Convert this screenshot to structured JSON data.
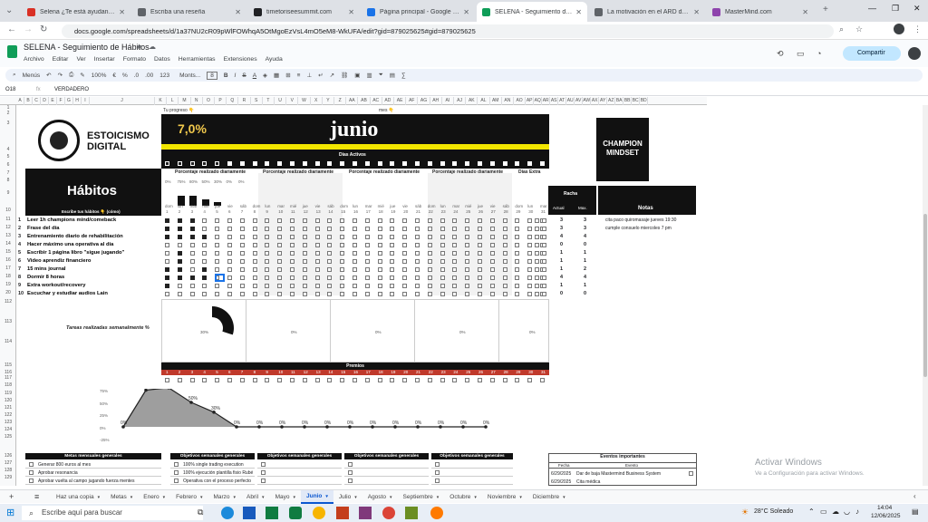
{
  "browser": {
    "tabs": [
      {
        "title": "Selena ¿Te está ayudando tu pi",
        "color": "#d93025"
      },
      {
        "title": "Escriba una reseña",
        "color": "#5f6368"
      },
      {
        "title": "timetoriseesummit.com",
        "color": "#202124"
      },
      {
        "title": "Página principal - Google Drive",
        "color": "#1a73e8"
      },
      {
        "title": "SELENA - Seguimiento de Háb",
        "color": "#0f9d58"
      },
      {
        "title": "La motivación en el ARD desd",
        "color": "#5f6368"
      },
      {
        "title": "MasterMind.com",
        "color": "#8e44ad"
      }
    ],
    "url": "docs.google.com/spreadsheets/d/1a37NU2cR09pWlFOWhqA5OtMgoEzVsL4mO5eM8-WkUFA/edit?gid=879025625#gid=879025625"
  },
  "doc": {
    "title": "SELENA - Seguimiento de Hábitos",
    "menu": [
      "Archivo",
      "Editar",
      "Ver",
      "Insertar",
      "Formato",
      "Datos",
      "Herramientas",
      "Extensiones",
      "Ayuda"
    ],
    "share": "Compartir"
  },
  "toolbar": {
    "menus": "Menús",
    "zoom": "100%",
    "font": "Monts...",
    "size": "8",
    "pct": "%",
    "fmt1": ".0",
    "fmt2": ".00",
    "fmt3": "123"
  },
  "formula": {
    "cell": "O18",
    "value": "VERDADERO"
  },
  "columns": [
    "A",
    "B",
    "C",
    "D",
    "E",
    "F",
    "G",
    "H",
    "I",
    "J",
    "K",
    "L",
    "M",
    "N",
    "O",
    "P",
    "Q",
    "R",
    "S",
    "T",
    "U",
    "V",
    "W",
    "X",
    "Y",
    "Z",
    "AA",
    "AB",
    "AC",
    "AD",
    "AE",
    "AF",
    "AG",
    "AH",
    "AI",
    "AJ",
    "AK",
    "AL",
    "AM",
    "AN",
    "AO",
    "AP",
    "AQ",
    "AR",
    "AS",
    "AT",
    "AU",
    "AV",
    "AW",
    "AX",
    "AY",
    "AZ",
    "BA",
    "BB",
    "BC",
    "BD"
  ],
  "rows": [
    "1",
    "2",
    "3",
    "4",
    "5",
    "6",
    "7",
    "8",
    "9",
    "10",
    "11",
    "12",
    "13",
    "14",
    "15",
    "16",
    "17",
    "18",
    "19",
    "20",
    "112",
    "113",
    "114",
    "115",
    "116",
    "117",
    "118",
    "119",
    "120",
    "121",
    "122",
    "123",
    "124",
    "125",
    "126",
    "127",
    "128",
    "129"
  ],
  "header": {
    "brand1": "ESTOICISMO",
    "brand2": "DIGITAL",
    "progress_label": "Tu progreso 👇",
    "progress": "7,0%",
    "month_label": "mes 👇",
    "month": "junio",
    "days_active": "Días Activos",
    "pct_label": "Porcentaje realizado diariamente",
    "extra_days": "Días Extra",
    "habits_title": "Hábitos",
    "habits_sub": "Escribe tus hábitos 👇 (cómo)",
    "racha": "Racha",
    "actual": "Actual",
    "max": "Max.",
    "notas": "Notas",
    "champion1": "CHAMPION",
    "champion2": "MINDSET"
  },
  "days_short": [
    "dom",
    "lun",
    "mar",
    "mié",
    "jue",
    "vie",
    "sáb"
  ],
  "habits": [
    {
      "n": "1",
      "name": "Leer 1h champions mind/comeback",
      "actual": "3",
      "max": "3",
      "note": "cita paco quiromasaje jueves 19:30",
      "checks": [
        1,
        1,
        1,
        0,
        0
      ]
    },
    {
      "n": "2",
      "name": "Frase del día",
      "actual": "3",
      "max": "3",
      "note": "cumple consuelo miercoles 7 pm",
      "checks": [
        1,
        1,
        1,
        0,
        0
      ]
    },
    {
      "n": "3",
      "name": "Entrenamiento diario de rehabilitación",
      "actual": "4",
      "max": "4",
      "note": "",
      "checks": [
        1,
        1,
        1,
        1,
        0
      ]
    },
    {
      "n": "4",
      "name": "Hacer máximo una operativa al día",
      "actual": "0",
      "max": "0",
      "note": "",
      "checks": [
        0,
        0,
        0,
        0,
        0
      ]
    },
    {
      "n": "5",
      "name": "Escribir 1 página libro \"sigue jugando\"",
      "actual": "1",
      "max": "1",
      "note": "",
      "checks": [
        0,
        1,
        0,
        0,
        0
      ]
    },
    {
      "n": "6",
      "name": "Video aprendiz financiero",
      "actual": "1",
      "max": "1",
      "note": "",
      "checks": [
        0,
        1,
        0,
        0,
        0
      ]
    },
    {
      "n": "7",
      "name": "15 mins journal",
      "actual": "1",
      "max": "2",
      "note": "",
      "checks": [
        1,
        1,
        0,
        1,
        0
      ]
    },
    {
      "n": "8",
      "name": "Dormir 8 horas",
      "actual": "4",
      "max": "4",
      "note": "",
      "checks": [
        1,
        1,
        1,
        1,
        0
      ]
    },
    {
      "n": "9",
      "name": "Extra workout/recovery",
      "actual": "1",
      "max": "1",
      "note": "",
      "checks": [
        1,
        0,
        0,
        0,
        0
      ]
    },
    {
      "n": "10",
      "name": "Escuchar y estudiar audios Lain",
      "actual": "0",
      "max": "0",
      "note": "",
      "checks": [
        0,
        0,
        0,
        0,
        0
      ]
    }
  ],
  "pct_row": [
    "0%",
    "75%",
    "80%",
    "50%",
    "30%",
    "0%",
    "0%"
  ],
  "weekly": {
    "label": "Tareas realizadas semanalmente %",
    "values": [
      "30%",
      "0%",
      "0%",
      "0%",
      "0%"
    ]
  },
  "premios": "Premios",
  "line_chart": {
    "y_ticks": [
      "75%",
      "50%",
      "25%",
      "0%",
      "-25%"
    ],
    "labels": [
      "0%",
      "75%",
      "80%",
      "50%",
      "30%",
      "0%",
      "0%",
      "0%",
      "0%",
      "0%",
      "0%",
      "0%",
      "0%",
      "0%",
      "0%",
      "0%",
      "0%"
    ]
  },
  "goals": {
    "headers": [
      "Metas mensuales generales",
      "Objetivos semanales generales",
      "Objetivos semanales generales",
      "Objetivos semanales generales",
      "Objetivos semanales generales"
    ],
    "monthly": [
      "Generar 800 euros al mes",
      "Aprobar resonancia",
      "Aprobar vuelta al campo jugando fuerza mentes"
    ],
    "week1": [
      "100% single trading execution",
      "100% ejecución plantilla fisio Rubén",
      "Operativa con el proceso perfecto"
    ]
  },
  "events": {
    "title": "Eventos importantes",
    "fecha": "Fecha",
    "evento": "Evento",
    "rows": [
      {
        "date": "6/29/2025",
        "text": "Dar de baja Mastermind Business System"
      },
      {
        "date": "6/29/2025",
        "text": "Cita médica"
      }
    ]
  },
  "watermark": {
    "line1": "Activar Windows",
    "line2": "Ve a Configuración para activar Windows."
  },
  "sheets": [
    "Haz una copia",
    "Metas",
    "Enero",
    "Febrero",
    "Marzo",
    "Abril",
    "Mayo",
    "Junio",
    "Julio",
    "Agosto",
    "Septiembre",
    "Octubre",
    "Noviembre",
    "Diciembre"
  ],
  "active_sheet": "Junio",
  "taskbar": {
    "search": "Escribe aquí para buscar",
    "weather": "28°C Soleado",
    "time": "14:04",
    "date": "12/06/2025"
  }
}
